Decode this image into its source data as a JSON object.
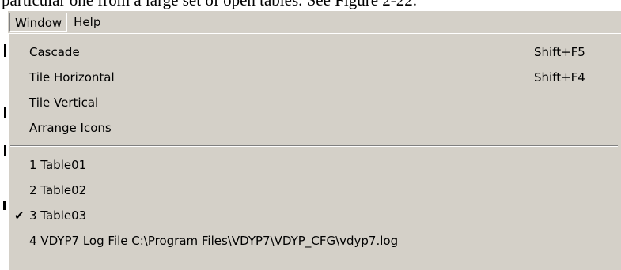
{
  "document": {
    "text": "particular one from a large set of open tables.  See Figure 2-22."
  },
  "menubar": {
    "items": [
      {
        "label": "Window",
        "open": true
      },
      {
        "label": "Help",
        "open": false
      }
    ]
  },
  "window_menu": {
    "commands": [
      {
        "label": "Cascade",
        "shortcut": "Shift+F5"
      },
      {
        "label": "Tile Horizontal",
        "shortcut": "Shift+F4"
      },
      {
        "label": "Tile Vertical",
        "shortcut": ""
      },
      {
        "label": "Arrange Icons",
        "shortcut": ""
      }
    ],
    "windows": [
      {
        "label": "1 Table01",
        "checked": false
      },
      {
        "label": "2 Table02",
        "checked": false
      },
      {
        "label": "3 Table03",
        "checked": true
      },
      {
        "label": "4 VDYP7 Log File C:\\Program Files\\VDYP7\\VDYP_CFG\\vdyp7.log",
        "checked": false
      }
    ],
    "check_glyph": "✔"
  }
}
